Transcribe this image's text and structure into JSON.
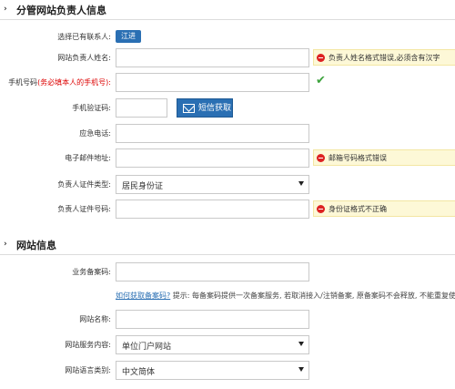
{
  "section1": {
    "title": "分管网站负责人信息"
  },
  "contact_row": {
    "label": "选择已有联系人:",
    "button": "江进"
  },
  "name_row": {
    "label": "网站负责人姓名:",
    "error": "负责人姓名格式错误,必须含有汉字"
  },
  "phone_row": {
    "label": "手机号码",
    "label_note": "(务必填本人的手机号):"
  },
  "code_row": {
    "label": "手机验证码:",
    "button": "短信获取"
  },
  "emergency_row": {
    "label": "应急电话:"
  },
  "email_row": {
    "label": "电子邮件地址:",
    "error": "邮箱号码格式错误"
  },
  "idtype_row": {
    "label": "负责人证件类型:",
    "value": "居民身份证"
  },
  "idnum_row": {
    "label": "负责人证件号码:",
    "error": "身份证格式不正确"
  },
  "section2": {
    "title": "网站信息"
  },
  "filing_row": {
    "label": "业务备案码:"
  },
  "filing_hint": {
    "link": "如何获取备案码?",
    "text": "提示: 每备案码提供一次备案服务, 若取消接入/注销备案, 原备案码不会释放, 不能重复使用."
  },
  "sitename_row": {
    "label": "网站名称:"
  },
  "service_row": {
    "label": "网站服务内容:",
    "value": "单位门户网站"
  },
  "language_row": {
    "label": "网站语言类别:",
    "value": "中文简体"
  }
}
